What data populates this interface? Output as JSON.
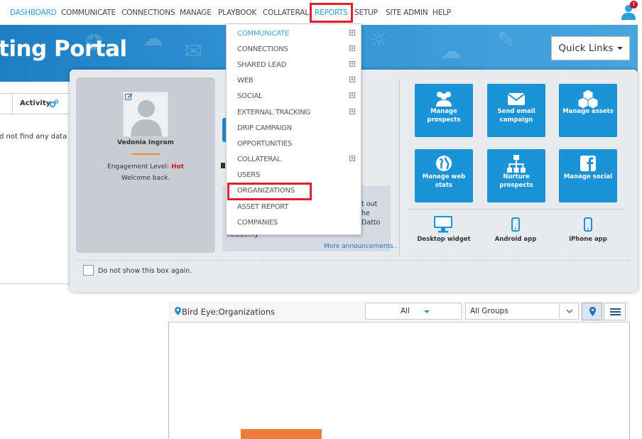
{
  "nav": {
    "items": [
      "DASHBOARD",
      "COMMUNICATE",
      "CONNECTIONS",
      "MANAGE",
      "PLAYBOOK",
      "COLLATERAL",
      "REPORTS",
      "SETUP",
      "SITE ADMIN",
      "HELP"
    ],
    "active": "DASHBOARD",
    "notification_count": "!"
  },
  "banner": {
    "title": "ting Portal"
  },
  "left": {
    "activity_tab": "Activity",
    "no_data_text": "d not find any data to"
  },
  "quick_links": {
    "button_label": "Quick Links"
  },
  "profile": {
    "name": "Vedonia Ingram",
    "engagement_label": "Engagement Level:",
    "engagement_value": "Hot",
    "welcome": "Welcome back."
  },
  "announcements": {
    "text_lines": [
      "t out",
      "he",
      "Datto"
    ],
    "text_lower": "Academy",
    "more_link": "More announcements.."
  },
  "tiles": [
    {
      "label": "Manage prospects",
      "icon": "people-icon"
    },
    {
      "label": "Send email campaign",
      "icon": "envelope-icon"
    },
    {
      "label": "Manage assets",
      "icon": "cubes-icon"
    },
    {
      "label": "Manage web stats",
      "icon": "globe-icon"
    },
    {
      "label": "Nurture prospects",
      "icon": "org-chart-icon"
    },
    {
      "label": "Manage social",
      "icon": "facebook-icon"
    }
  ],
  "apps": [
    {
      "label": "Desktop widget",
      "icon": "monitor-icon"
    },
    {
      "label": "Android app",
      "icon": "phone-icon"
    },
    {
      "label": "iPhone app",
      "icon": "phone-icon"
    }
  ],
  "dont_show": "Do not show this box again.",
  "bird_eye": {
    "title": "Bird Eye:Organizations",
    "filter_all": "All",
    "filter_groups": "All Groups"
  },
  "reports_menu": {
    "items": [
      {
        "label": "COMMUNICATE",
        "has_sub": true,
        "active": true
      },
      {
        "label": "CONNECTIONS",
        "has_sub": true
      },
      {
        "label": "SHARED LEAD",
        "has_sub": true
      },
      {
        "label": "WEB",
        "has_sub": true
      },
      {
        "label": "SOCIAL",
        "has_sub": true
      },
      {
        "label": "EXTERNAL TRACKING",
        "has_sub": true
      },
      {
        "label": "DRIP CAMPAIGN",
        "has_sub": false
      },
      {
        "label": "OPPORTUNITIES",
        "has_sub": false
      },
      {
        "label": "COLLATERAL",
        "has_sub": true
      },
      {
        "label": "USERS",
        "has_sub": false
      },
      {
        "label": "ORGANIZATIONS",
        "has_sub": false
      },
      {
        "label": "ASSET REPORT",
        "has_sub": false
      },
      {
        "label": "COMPANIES",
        "has_sub": false
      }
    ],
    "plus_glyph": "+"
  },
  "colors": {
    "accent": "#2a9fd8",
    "tile": "#1b93d8",
    "highlight": "#e0202a",
    "hot": "#d01e1e"
  }
}
